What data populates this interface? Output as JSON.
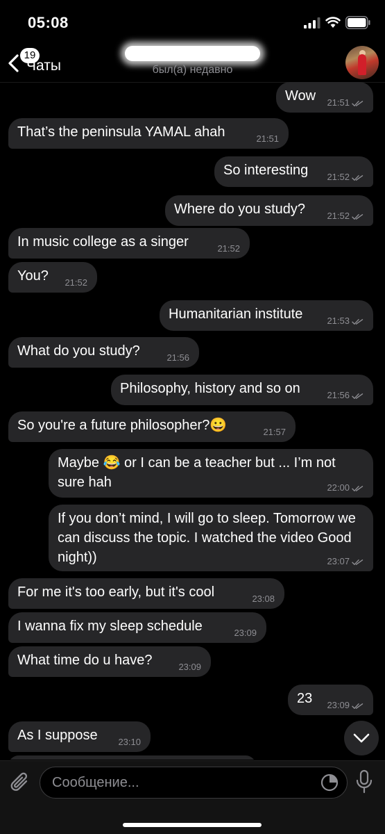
{
  "status_bar": {
    "time": "05:08"
  },
  "header": {
    "back_label": "Чаты",
    "unread_count": "19",
    "contact_status": "был(а) недавно"
  },
  "messages": [
    {
      "dir": "out",
      "text": "Wow",
      "time": "21:51",
      "read": true
    },
    {
      "dir": "in",
      "text": "That’s the peninsula YAMAL ahah",
      "time": "21:51"
    },
    {
      "dir": "out",
      "text": "So interesting",
      "time": "21:52",
      "read": true
    },
    {
      "dir": "out",
      "text": "Where do you study?",
      "time": "21:52",
      "read": true
    },
    {
      "dir": "in",
      "text": "In music college as a singer",
      "time": "21:52"
    },
    {
      "dir": "in",
      "text": "You?",
      "time": "21:52"
    },
    {
      "dir": "out",
      "text": "Humanitarian institute",
      "time": "21:53",
      "read": true
    },
    {
      "dir": "in",
      "text": "What do you study?",
      "time": "21:56"
    },
    {
      "dir": "out",
      "text": "Philosophy, history and so on",
      "time": "21:56",
      "read": true
    },
    {
      "dir": "in",
      "text": "So you're a future philosopher?😀",
      "time": "21:57"
    },
    {
      "dir": "out",
      "text": "Maybe 😂 or I can be a teacher but ... I’m not sure hah",
      "time": "22:00",
      "read": true
    },
    {
      "dir": "out",
      "text": "If you don’t mind, I will go to sleep. Tomorrow we can discuss the topic. I watched the video Good night))",
      "time": "23:07",
      "read": true
    },
    {
      "dir": "in",
      "text": "For me it's too early, but it's cool",
      "time": "23:08"
    },
    {
      "dir": "in",
      "text": "I wanna fix my sleep schedule",
      "time": "23:09"
    },
    {
      "dir": "in",
      "text": "What time do u have?",
      "time": "23:09"
    },
    {
      "dir": "out",
      "text": "23",
      "time": "23:09",
      "read": true
    },
    {
      "dir": "in",
      "text": "As I suppose",
      "time": "23:10"
    }
  ],
  "input": {
    "placeholder": "Сообщение..."
  },
  "colors": {
    "background": "#000000",
    "bubble": "#262628",
    "meta": "#8e8e93"
  },
  "icons": [
    "back-chevron-icon",
    "attach-icon",
    "sticker-icon",
    "microphone-icon",
    "chevron-down-icon",
    "double-check-icon"
  ]
}
